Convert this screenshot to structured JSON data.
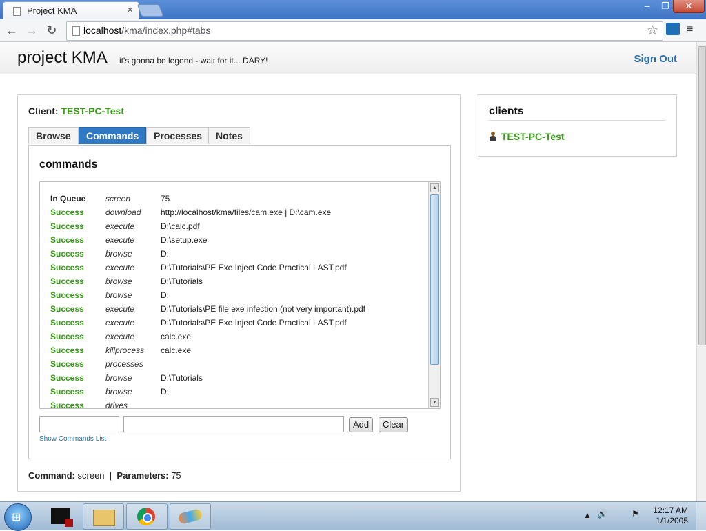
{
  "browser": {
    "tab_title": "Project KMA",
    "tab_close": "×",
    "url_host": "localhost",
    "url_path": "/kma/index.php#tabs",
    "back": "←",
    "forward": "→",
    "reload": "↻",
    "star": "☆",
    "menu": "≡",
    "minimize": "–",
    "maximize": "❐",
    "close": "✕"
  },
  "header": {
    "brand": "project KMA",
    "tagline": "it's gonna be legend - wait for it... DARY!",
    "sign_out": "Sign Out"
  },
  "client_panel": {
    "client_label": "Client:",
    "client_name": "TEST-PC-Test",
    "tabs": [
      {
        "label": "Browse",
        "active": false
      },
      {
        "label": "Commands",
        "active": true
      },
      {
        "label": "Processes",
        "active": false
      },
      {
        "label": "Notes",
        "active": false
      }
    ],
    "section_title": "commands",
    "commands": [
      {
        "status": "In Queue",
        "command": "screen",
        "params": "75"
      },
      {
        "status": "Success",
        "command": "download",
        "params": "http://localhost/kma/files/cam.exe | D:\\cam.exe"
      },
      {
        "status": "Success",
        "command": "execute",
        "params": "D:\\calc.pdf"
      },
      {
        "status": "Success",
        "command": "execute",
        "params": "D:\\setup.exe"
      },
      {
        "status": "Success",
        "command": "browse",
        "params": "D:"
      },
      {
        "status": "Success",
        "command": "execute",
        "params": "D:\\Tutorials\\PE Exe Inject Code Practical LAST.pdf"
      },
      {
        "status": "Success",
        "command": "browse",
        "params": "D:\\Tutorials"
      },
      {
        "status": "Success",
        "command": "browse",
        "params": "D:"
      },
      {
        "status": "Success",
        "command": "execute",
        "params": "D:\\Tutorials\\PE file exe infection (not very important).pdf"
      },
      {
        "status": "Success",
        "command": "execute",
        "params": "D:\\Tutorials\\PE Exe Inject Code Practical LAST.pdf"
      },
      {
        "status": "Success",
        "command": "execute",
        "params": "calc.exe"
      },
      {
        "status": "Success",
        "command": "killprocess",
        "params": "calc.exe"
      },
      {
        "status": "Success",
        "command": "processes",
        "params": ""
      },
      {
        "status": "Success",
        "command": "browse",
        "params": "D:\\Tutorials"
      },
      {
        "status": "Success",
        "command": "browse",
        "params": "D:"
      },
      {
        "status": "Success",
        "command": "drives",
        "params": ""
      }
    ],
    "command_input_value": "",
    "params_input_value": "",
    "add_label": "Add",
    "clear_label": "Clear",
    "show_list_label": "Show Commands List",
    "status": {
      "command_label": "Command:",
      "command_value": "screen",
      "separator": "|",
      "params_label": "Parameters:",
      "params_value": "75"
    }
  },
  "clients_panel": {
    "title": "clients",
    "items": [
      "TEST-PC-Test"
    ]
  },
  "taskbar": {
    "start_glyph": "⊞",
    "time": "12:17 AM",
    "date": "1/1/2005"
  },
  "colors": {
    "success": "#3a9a1a",
    "queue": "#222222",
    "active_tab": "#2f79c4",
    "link": "#2d6ea5"
  }
}
